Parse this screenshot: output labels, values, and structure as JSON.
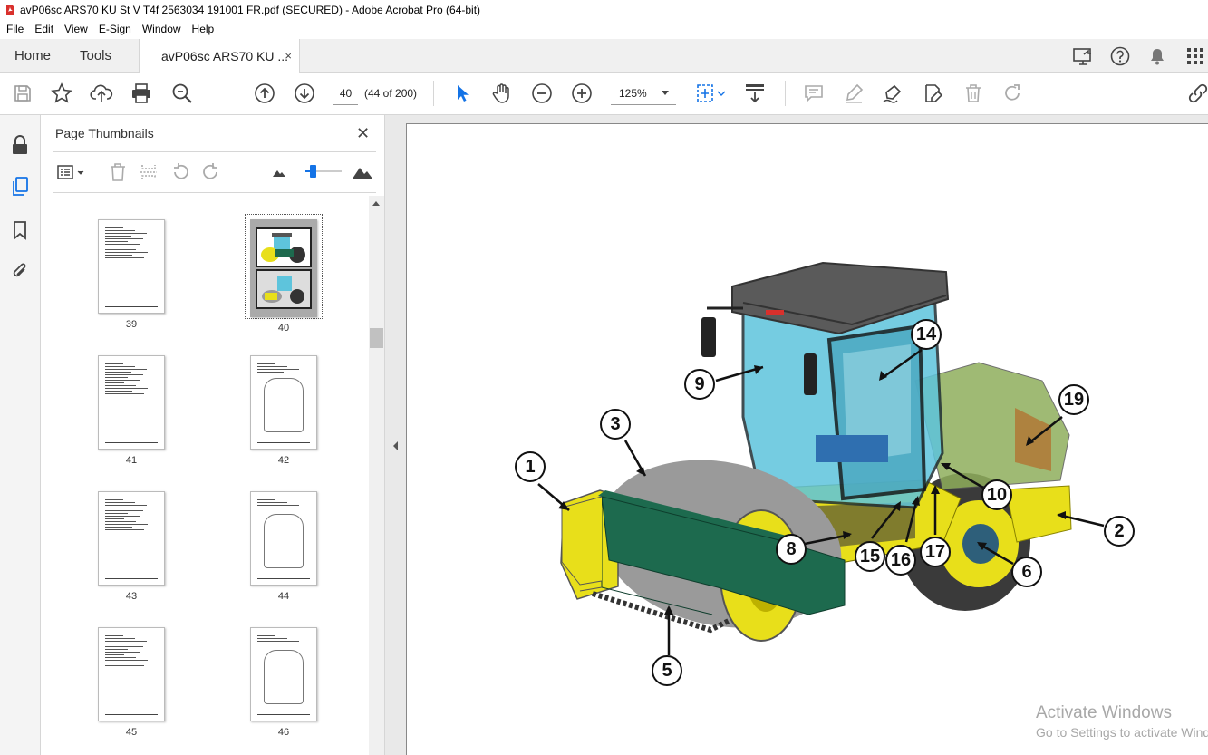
{
  "window": {
    "title": "avP06sc ARS70 KU St V T4f 2563034 191001 FR.pdf (SECURED) - Adobe Acrobat Pro (64-bit)",
    "controls": [
      "minimize",
      "maximize",
      "close"
    ]
  },
  "menu": [
    "File",
    "Edit",
    "View",
    "E-Sign",
    "Window",
    "Help"
  ],
  "tabs": {
    "home": "Home",
    "tools": "Tools",
    "document": "avP06sc ARS70 KU ...",
    "close": "×"
  },
  "toolbar": {
    "page_number": "40",
    "page_count": "(44 of 200)",
    "zoom": "125%"
  },
  "panel": {
    "title": "Page Thumbnails",
    "close": "✕",
    "slider_level": 0.15,
    "thumbnails": [
      {
        "label": "39",
        "selected": false
      },
      {
        "label": "40",
        "selected": true
      },
      {
        "label": "41",
        "selected": false
      },
      {
        "label": "42",
        "selected": false
      },
      {
        "label": "43",
        "selected": false
      },
      {
        "label": "44",
        "selected": false
      },
      {
        "label": "45",
        "selected": false
      },
      {
        "label": "46",
        "selected": false
      }
    ]
  },
  "figure": {
    "callouts": [
      "1",
      "2",
      "3",
      "5",
      "6",
      "8",
      "9",
      "10",
      "14",
      "15",
      "16",
      "17",
      "19"
    ],
    "colors": {
      "machine_yellow": "#e8df1a",
      "frame_green": "#1d6a4e",
      "cab_glass": "#5ec4dc",
      "roof": "#5a5a5a",
      "drum_gray": "#9a9a9a",
      "tire": "#3a3a3a"
    }
  },
  "watermark": {
    "line1": "Activate Windows",
    "line2": "Go to Settings to activate Windows."
  },
  "colors": {
    "accent": "#1473e6",
    "pdf_red": "#d9302c"
  }
}
